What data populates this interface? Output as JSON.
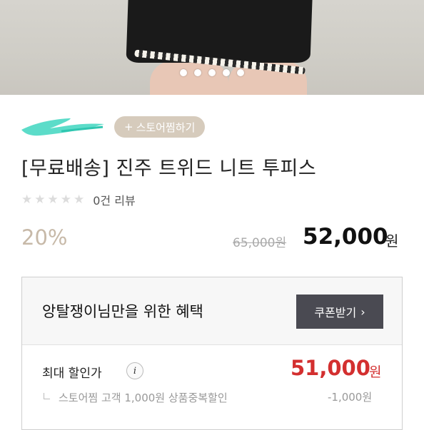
{
  "product": {
    "store_follow_label": "스토어찜하기",
    "store_follow_plus": "+",
    "title": "[무료배송] 진주 트위드 니트 투피스",
    "review_count_text": "0건 리뷰",
    "star_rating": 0,
    "stars_total": 5,
    "discount_rate": "20%",
    "original_price": "65,000원",
    "sale_price": "52,000",
    "sale_unit": "원",
    "image_slide_count": 5
  },
  "benefit": {
    "title": "앙탈쟁이님만을 위한 혜택",
    "coupon_label": "쿠폰받기",
    "coupon_chevron": "›",
    "max_discount_label": "최대 할인가",
    "info_icon_glyph": "i",
    "max_price": "51,000",
    "max_unit": "원",
    "detail_text": "스토어찜 고객 1,000원 상품중복할인",
    "detail_amount": "-1,000원"
  },
  "colors": {
    "follow_button_bg": "#d6cbbc",
    "discount_text": "#c7b9a8",
    "max_price_red": "#d32f2f",
    "coupon_button_bg": "#4a4a52",
    "scribble_mint": "#3fd6c0"
  },
  "icons": {
    "star": "star-icon",
    "info": "info-icon",
    "chevron": "chevron-right-icon",
    "plus": "plus-icon"
  }
}
